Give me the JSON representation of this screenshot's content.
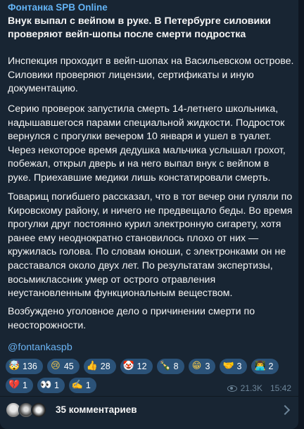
{
  "post": {
    "channel_name": "Фонтанка SPB Online",
    "headline": "Внук выпал с вейпом в руке. В Петербурге силовики проверяют вейп-шопы после смерти подростка",
    "paragraphs": [
      "Инспекция проходит в вейп-шопах на Васильевском острове. Силовики проверяют лицензии, сертификаты и иную документацию.",
      "Серию проверок запустила смерть 14-летнего школьника, надышавшегося парами специальной жидкости. Подросток вернулся с прогулки вечером 10 января и ушел в туалет. Через некоторое время дедушка мальчика услышал грохот, побежал, открыл дверь и на него выпал внук с вейпом в руке. Приехавшие медики лишь констатировали смерть.",
      "Товарищ погибшего рассказал, что в тот вечер они гуляли по Кировскому району, и ничего не предвещало беды. Во время прогулки друг постоянно курил электронную сигарету, хотя ранее ему неоднократно становилось плохо от них — кружилась голова. По словам юноши, с электронками он не расставался около двух лет. По результатам экспертизы, восьмиклассник умер от острого отравления неустановленным функциональным веществом.",
      "Возбуждено уголовное дело о причинении смерти по неосторожности."
    ],
    "hashtag": "@fontankaspb",
    "views": "21.3K",
    "time": "15:42"
  },
  "reactions": {
    "row1": [
      {
        "icon": "exploding-head-emoji",
        "glyph": "🤯",
        "count": "136",
        "color": "#f4b400"
      },
      {
        "icon": "crying-face-emoji",
        "glyph": "😢",
        "count": "45",
        "color": "#f7c948"
      },
      {
        "icon": "thumbs-up-emoji",
        "glyph": "👍",
        "count": "28",
        "color": "#f4b400"
      },
      {
        "icon": "clown-face-emoji",
        "glyph": "🤡",
        "count": "12",
        "color": "#ffffff"
      },
      {
        "icon": "champagne-emoji",
        "glyph": "🍾",
        "count": "8",
        "color": "#3c9a3c"
      },
      {
        "icon": "beaming-face-emoji",
        "glyph": "😁",
        "count": "3",
        "color": "#f7c948"
      },
      {
        "icon": "handshake-emoji",
        "glyph": "🤝",
        "count": "3",
        "color": "#f4b400"
      },
      {
        "icon": "man-technologist-emoji",
        "glyph": "👨‍💻",
        "count": "2",
        "color": "#d4a373"
      }
    ],
    "row2": [
      {
        "icon": "broken-heart-emoji",
        "glyph": "💔",
        "count": "1",
        "color": "#e53935"
      },
      {
        "icon": "eyes-emoji",
        "glyph": "👀",
        "count": "1",
        "color": "#ffffff"
      },
      {
        "icon": "writing-hand-emoji",
        "glyph": "✍️",
        "count": "1",
        "color": "#f4b400"
      }
    ]
  },
  "comments": {
    "label": "35 комментариев"
  },
  "colors": {
    "background": "#0e1621",
    "bubble": "#182533",
    "channel_name": "#63b3f5",
    "link": "#6ab3f3",
    "reaction_bg": "#2b5278",
    "meta_text": "#6d8599"
  }
}
